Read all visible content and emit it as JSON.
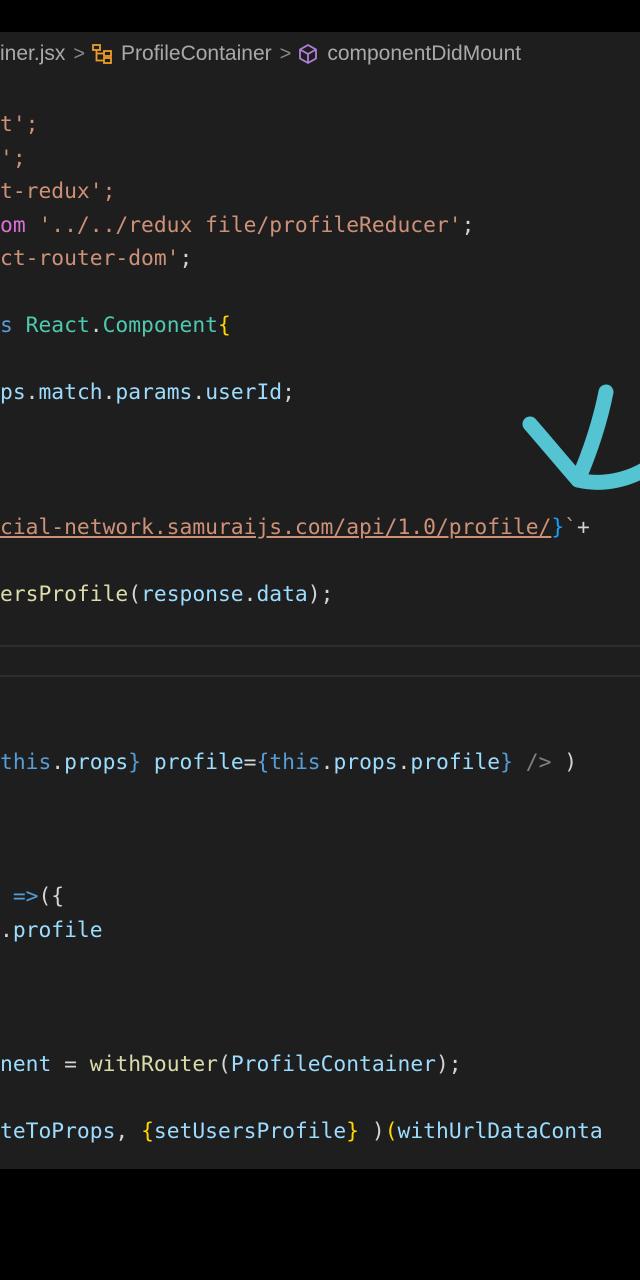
{
  "breadcrumb": {
    "file": "iner.jsx",
    "component": "ProfileContainer",
    "method": "componentDidMount"
  },
  "code_lines": [
    [
      {
        "t": "t';",
        "c": "str"
      }
    ],
    [
      {
        "t": "';",
        "c": "str"
      }
    ],
    [
      {
        "t": "t-redux';",
        "c": "str"
      }
    ],
    [
      {
        "t": "om ",
        "c": "br"
      },
      {
        "t": "'../../redux file/profileReducer'",
        "c": "str"
      },
      {
        "t": ";",
        "c": "pl"
      }
    ],
    [
      {
        "t": "ct-router-dom'",
        "c": "str"
      },
      {
        "t": ";",
        "c": "pl"
      }
    ],
    [
      {
        "t": "s ",
        "c": "kw"
      },
      {
        "t": "React",
        "c": "cls"
      },
      {
        "t": ".",
        "c": "pl"
      },
      {
        "t": "Component",
        "c": "cls"
      },
      {
        "t": "{",
        "c": "br2"
      }
    ],
    [
      {
        "t": "ps",
        "c": "var"
      },
      {
        "t": ".",
        "c": "pl"
      },
      {
        "t": "match",
        "c": "var"
      },
      {
        "t": ".",
        "c": "pl"
      },
      {
        "t": "params",
        "c": "var"
      },
      {
        "t": ".",
        "c": "pl"
      },
      {
        "t": "userId",
        "c": "var"
      },
      {
        "t": ";",
        "c": "pl"
      }
    ],
    [
      {
        "t": "cial-network.samuraijs.com/api/1.0/profile/",
        "c": "str url"
      },
      {
        "t": "}",
        "c": "br3"
      },
      {
        "t": "`",
        "c": "str"
      },
      {
        "t": "+ ",
        "c": "pl"
      }
    ],
    [
      {
        "t": "ersProfile",
        "c": "fn"
      },
      {
        "t": "(",
        "c": "pl"
      },
      {
        "t": "response",
        "c": "var"
      },
      {
        "t": ".",
        "c": "pl"
      },
      {
        "t": "data",
        "c": "var"
      },
      {
        "t": ");",
        "c": "pl"
      }
    ],
    [
      {
        "t": "this",
        "c": "kw"
      },
      {
        "t": ".",
        "c": "pl"
      },
      {
        "t": "props",
        "c": "var"
      },
      {
        "t": "}",
        "c": "kw"
      },
      {
        "t": " ",
        "c": "pl"
      },
      {
        "t": "profile",
        "c": "var"
      },
      {
        "t": "=",
        "c": "pl"
      },
      {
        "t": "{",
        "c": "kw"
      },
      {
        "t": "this",
        "c": "kw"
      },
      {
        "t": ".",
        "c": "pl"
      },
      {
        "t": "props",
        "c": "var"
      },
      {
        "t": ".",
        "c": "pl"
      },
      {
        "t": "profile",
        "c": "var"
      },
      {
        "t": "}",
        "c": "kw"
      },
      {
        "t": " />",
        "c": "tag"
      },
      {
        "t": " )",
        "c": "pl"
      }
    ],
    [
      {
        "t": " =>",
        "c": "kw"
      },
      {
        "t": "({",
        "c": "pl"
      }
    ],
    [
      {
        "t": ".",
        "c": "pl"
      },
      {
        "t": "profile",
        "c": "var"
      }
    ],
    [
      {
        "t": "nent",
        "c": "var"
      },
      {
        "t": " = ",
        "c": "pl"
      },
      {
        "t": "withRouter",
        "c": "fn"
      },
      {
        "t": "(",
        "c": "pl"
      },
      {
        "t": "ProfileContainer",
        "c": "var"
      },
      {
        "t": ");",
        "c": "pl"
      }
    ],
    [
      {
        "t": "teToProps",
        "c": "var"
      },
      {
        "t": ", ",
        "c": "pl"
      },
      {
        "t": "{",
        "c": "br2"
      },
      {
        "t": "setUsersProfile",
        "c": "var"
      },
      {
        "t": "}",
        "c": "br2"
      },
      {
        "t": " )",
        "c": "pl"
      },
      {
        "t": "(",
        "c": "br2"
      },
      {
        "t": "withUrlDataConta",
        "c": "var"
      }
    ]
  ],
  "colors": {
    "editor_background": "#1e1e1e",
    "string": "#ce9178",
    "keyword": "#569cd6",
    "type": "#4ec9b0",
    "variable": "#9cdcfe",
    "function": "#dcdcaa",
    "annotation_arrow": "#54c3d2"
  },
  "icons": [
    "chevron-right-icon",
    "symbol-class-icon",
    "symbol-method-icon"
  ]
}
